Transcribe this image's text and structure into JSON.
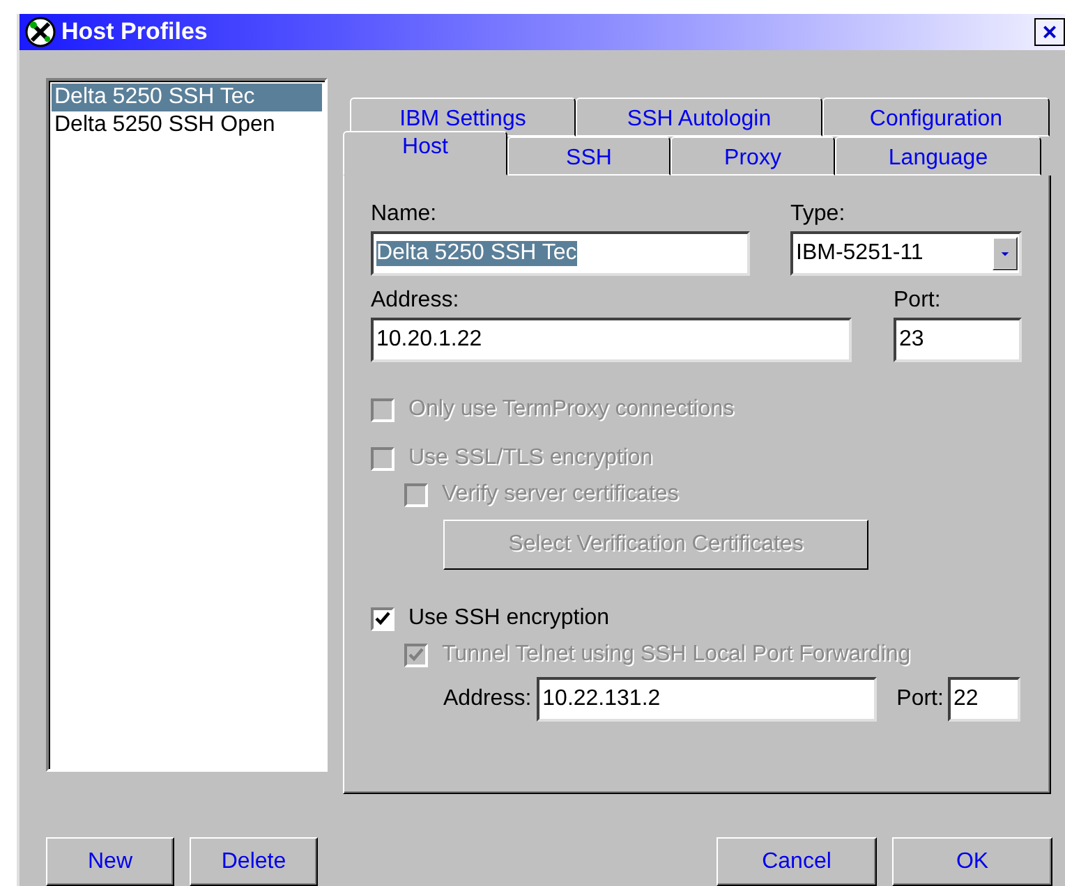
{
  "window": {
    "title": "Host Profiles",
    "close": "×"
  },
  "profiles": [
    {
      "label": "Delta 5250 SSH Tec",
      "selected": true
    },
    {
      "label": "Delta 5250 SSH Open",
      "selected": false
    }
  ],
  "tab_rows": [
    [
      {
        "label": "IBM Settings",
        "selected": false
      },
      {
        "label": "SSH Autologin",
        "selected": false
      },
      {
        "label": "Configuration",
        "selected": false
      }
    ],
    [
      {
        "label": "Host",
        "selected": true
      },
      {
        "label": "SSH",
        "selected": false
      },
      {
        "label": "Proxy",
        "selected": false
      },
      {
        "label": "Language",
        "selected": false
      }
    ]
  ],
  "host": {
    "name_label": "Name:",
    "name_value": "Delta 5250 SSH Tec",
    "type_label": "Type:",
    "type_value": "IBM-5251-11",
    "address_label": "Address:",
    "address_value": "10.20.1.22",
    "port_label": "Port:",
    "port_value": "23"
  },
  "options": [
    {
      "kind": "checkbox",
      "label": "Only use TermProxy connections",
      "checked": false,
      "disabled": true
    },
    {
      "kind": "checkbox",
      "label": "Use SSL/TLS encryption",
      "checked": false,
      "disabled": true,
      "children": [
        {
          "kind": "checkbox",
          "label": "Verify server certificates",
          "checked": false,
          "disabled": true
        },
        {
          "kind": "button",
          "label": "Select Verification Certificates",
          "disabled": true
        }
      ]
    },
    {
      "kind": "checkbox",
      "label": "Use SSH encryption",
      "checked": true,
      "disabled": false,
      "children": [
        {
          "kind": "checkbox",
          "label": "Tunnel Telnet using SSH Local Port Forwarding",
          "checked": true,
          "disabled": true
        }
      ]
    }
  ],
  "tunnel": {
    "address_label": "Address:",
    "address_value": "10.22.131.2",
    "port_label": "Port:",
    "port_value": "22"
  },
  "buttons_left": [
    "New",
    "Delete"
  ],
  "buttons_right": [
    "Cancel",
    "OK"
  ]
}
